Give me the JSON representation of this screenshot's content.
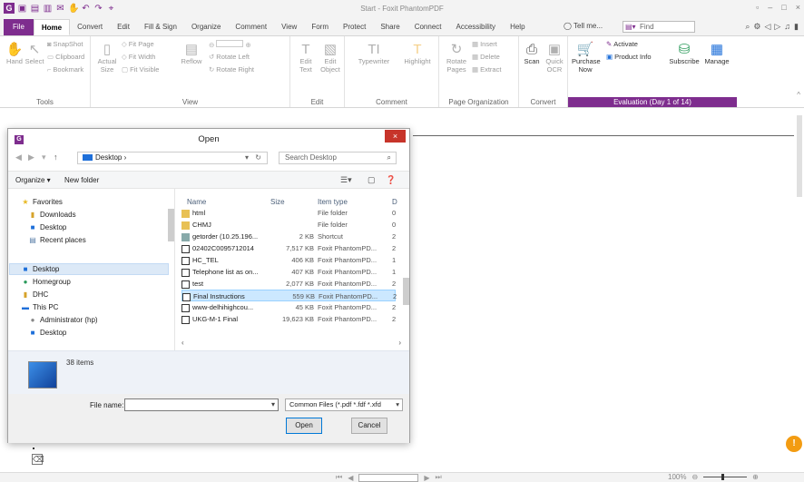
{
  "app": {
    "title": "Start - Foxit PhantomPDF",
    "logo": "G"
  },
  "qat": {
    "icons": [
      "open-icon",
      "save-icon",
      "print-icon",
      "email-icon",
      "hand-icon",
      "undo-icon",
      "redo-icon",
      "select-icon"
    ]
  },
  "tabs": [
    "File",
    "Home",
    "Convert",
    "Edit",
    "Fill & Sign",
    "Organize",
    "Comment",
    "View",
    "Form",
    "Protect",
    "Share",
    "Connect",
    "Accessibility",
    "Help"
  ],
  "active_tab": "Home",
  "tell_me": "Tell me...",
  "find_placeholder": "Find",
  "ribbon": {
    "tools": {
      "label": "Tools",
      "hand": "Hand",
      "select": "Select",
      "snapshot": "SnapShot",
      "clipboard": "Clipboard",
      "bookmark": "Bookmark"
    },
    "view": {
      "label": "View",
      "actual_size": "Actual Size",
      "fit_page": "Fit Page",
      "fit_width": "Fit Width",
      "fit_visible": "Fit Visible",
      "reflow": "Reflow",
      "rotate_left": "Rotate Left",
      "rotate_right": "Rotate Right"
    },
    "edit": {
      "label": "Edit",
      "edit_text": "Edit Text",
      "edit_object": "Edit Object"
    },
    "comment": {
      "label": "Comment",
      "typewriter": "Typewriter",
      "highlight": "Highlight"
    },
    "page_org": {
      "label": "Page Organization",
      "rotate_pages": "Rotate Pages",
      "insert": "Insert",
      "delete": "Delete",
      "extract": "Extract"
    },
    "convert": {
      "label": "Convert",
      "scan": "Scan",
      "quick_ocr": "Quick OCR"
    },
    "evaluation": {
      "label": "Evaluation (Day 1 of 14)",
      "purchase_now": "Purchase Now",
      "activate": "Activate",
      "product_info": "Product Info",
      "subscribe": "Subscribe",
      "manage": "Manage"
    }
  },
  "dialog": {
    "title": "Open",
    "close": "×",
    "address": "Desktop",
    "search_placeholder": "Search Desktop",
    "organize": "Organize ▾",
    "new_folder": "New folder",
    "nav": [
      "Favorites",
      "Downloads",
      "Desktop",
      "Recent places",
      "Desktop",
      "Homegroup",
      "DHC",
      "This PC",
      "Administrator (hp)",
      "Desktop"
    ],
    "columns": {
      "name": "Name",
      "size": "Size",
      "type": "Item type",
      "date": "D"
    },
    "files": [
      {
        "name": "html",
        "size": "",
        "type": "File folder",
        "date": "0",
        "kind": "folder"
      },
      {
        "name": "CHMJ",
        "size": "",
        "type": "File folder",
        "date": "0",
        "kind": "folder"
      },
      {
        "name": "getorder (10.25.196...",
        "size": "2 KB",
        "type": "Shortcut",
        "date": "2",
        "kind": "sc"
      },
      {
        "name": "02402C0095712014",
        "size": "7,517 KB",
        "type": "Foxit PhantomPD...",
        "date": "2",
        "kind": "pdf"
      },
      {
        "name": "HC_TEL",
        "size": "406 KB",
        "type": "Foxit PhantomPD...",
        "date": "1",
        "kind": "pdf"
      },
      {
        "name": "Telephone list as on...",
        "size": "407 KB",
        "type": "Foxit PhantomPD...",
        "date": "1",
        "kind": "pdf"
      },
      {
        "name": "test",
        "size": "2,077 KB",
        "type": "Foxit PhantomPD...",
        "date": "2",
        "kind": "pdf"
      },
      {
        "name": "Final Instructions",
        "size": "559 KB",
        "type": "Foxit PhantomPD...",
        "date": "2",
        "kind": "pdf"
      },
      {
        "name": "www-delhihighcou...",
        "size": "45 KB",
        "type": "Foxit PhantomPD...",
        "date": "2",
        "kind": "pdf"
      },
      {
        "name": "UKG-M-1 Final",
        "size": "19,623 KB",
        "type": "Foxit PhantomPD...",
        "date": "2",
        "kind": "pdf"
      }
    ],
    "item_count": "38 items",
    "file_name_label": "File name:",
    "file_name_value": "",
    "file_type": "Common Files (*.pdf *.fdf *.xfd",
    "open": "Open",
    "cancel": "Cancel"
  },
  "status": {
    "zoom": "100%"
  },
  "colors": {
    "accent": "#7e2d8e",
    "selection": "#cce8ff",
    "close_red": "#c7342a"
  }
}
